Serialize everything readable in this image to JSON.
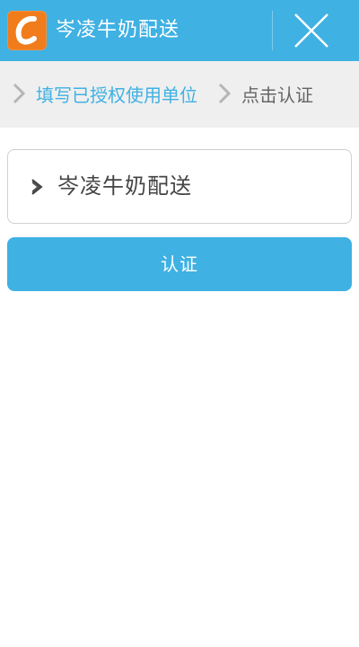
{
  "header": {
    "title": "岑凌牛奶配送",
    "logo_icon": "c-logo-icon",
    "close_icon": "close-icon"
  },
  "breadcrumb": {
    "steps": [
      {
        "label": "填写已授权使用单位",
        "state": "active"
      },
      {
        "label": "点击认证",
        "state": "inactive"
      }
    ]
  },
  "unit": {
    "name": "岑凌牛奶配送"
  },
  "actions": {
    "certify_label": "认证"
  },
  "colors": {
    "brand_blue": "#3fb1e3",
    "logo_orange": "#f07c1c",
    "crumb_bg": "#efefef",
    "inactive_text": "#666666"
  }
}
